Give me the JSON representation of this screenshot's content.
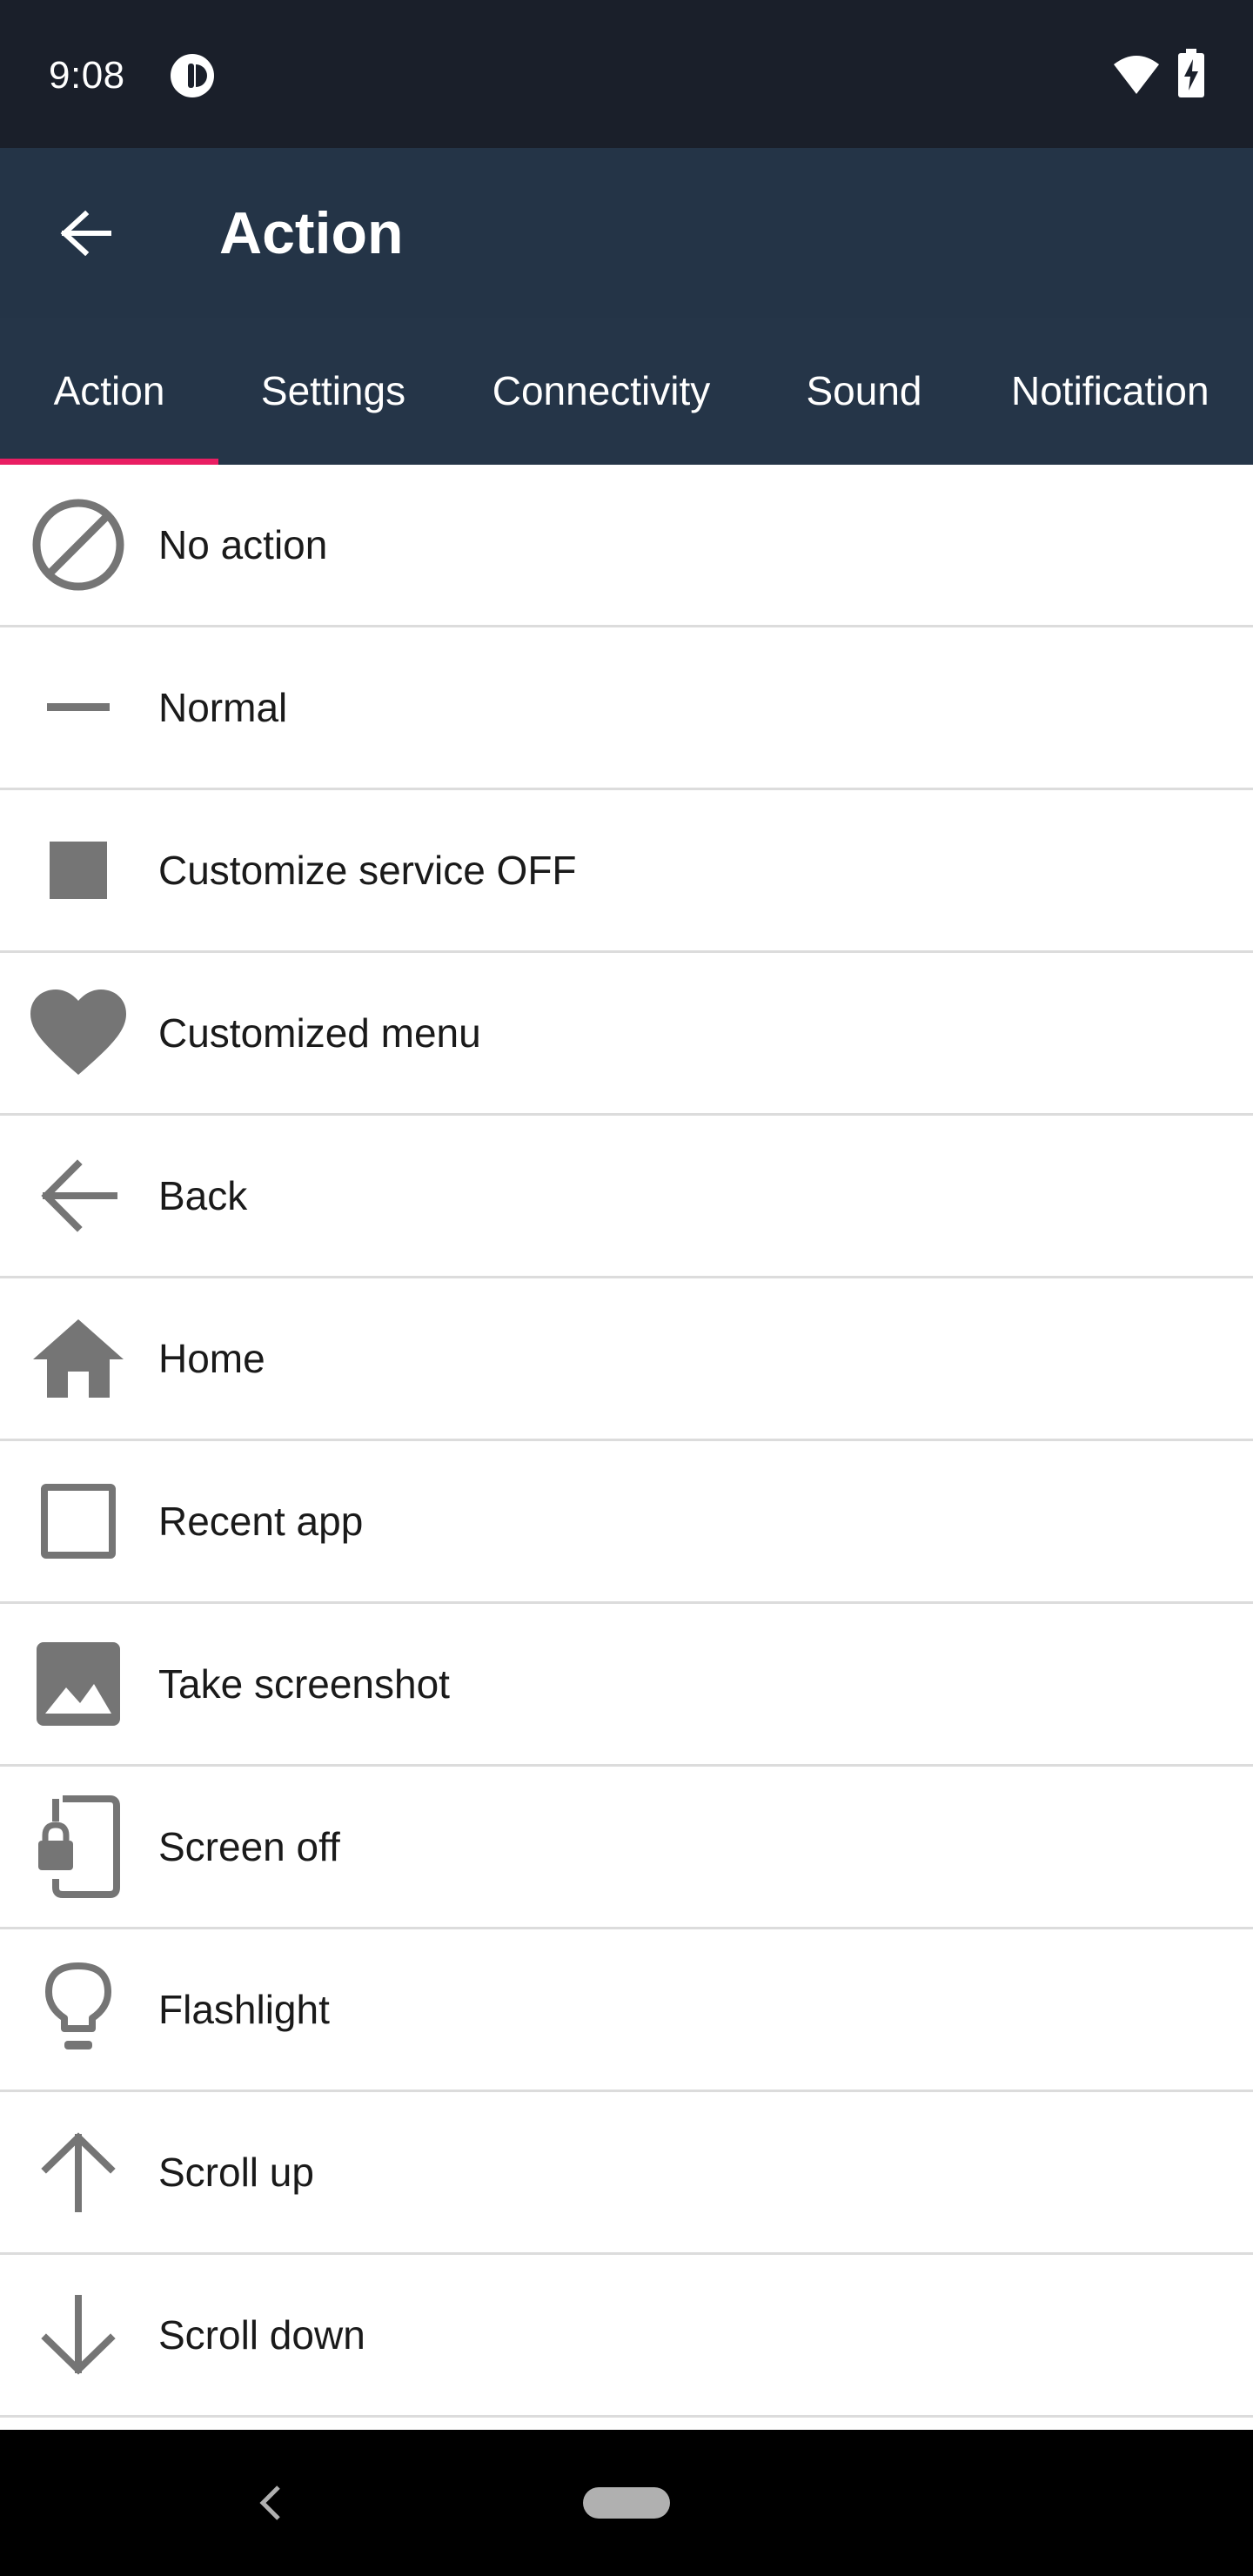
{
  "status_bar": {
    "time": "9:08",
    "icons": [
      "app-notification-icon",
      "wifi-icon",
      "battery-charging-icon"
    ]
  },
  "app_bar": {
    "title": "Action",
    "back_icon": "arrow-back-icon"
  },
  "tabs": [
    {
      "label": "Action",
      "selected": true
    },
    {
      "label": "Settings",
      "selected": false
    },
    {
      "label": "Connectivity",
      "selected": false
    },
    {
      "label": "Sound",
      "selected": false
    },
    {
      "label": "Notification",
      "selected": false
    }
  ],
  "colors": {
    "status_bar_bg": "#1a1f2a",
    "app_bar_bg": "#243447",
    "tab_indicator": "#e91e63",
    "icon_gray": "#757575",
    "divider": "#dcdcdc"
  },
  "actions": [
    {
      "label": "No action",
      "icon": "block-icon"
    },
    {
      "label": "Normal",
      "icon": "minus-icon"
    },
    {
      "label": "Customize service OFF",
      "icon": "stop-square-icon"
    },
    {
      "label": "Customized menu",
      "icon": "heart-icon"
    },
    {
      "label": "Back",
      "icon": "arrow-back-icon"
    },
    {
      "label": "Home",
      "icon": "home-icon"
    },
    {
      "label": "Recent app",
      "icon": "square-outline-icon"
    },
    {
      "label": "Take screenshot",
      "icon": "image-icon"
    },
    {
      "label": "Screen off",
      "icon": "phone-lock-icon"
    },
    {
      "label": "Flashlight",
      "icon": "lightbulb-icon"
    },
    {
      "label": "Scroll up",
      "icon": "arrow-up-icon"
    },
    {
      "label": "Scroll down",
      "icon": "arrow-down-icon"
    }
  ],
  "nav_bar": {
    "back_icon": "nav-back-icon",
    "home_icon": "nav-home-pill-icon"
  }
}
